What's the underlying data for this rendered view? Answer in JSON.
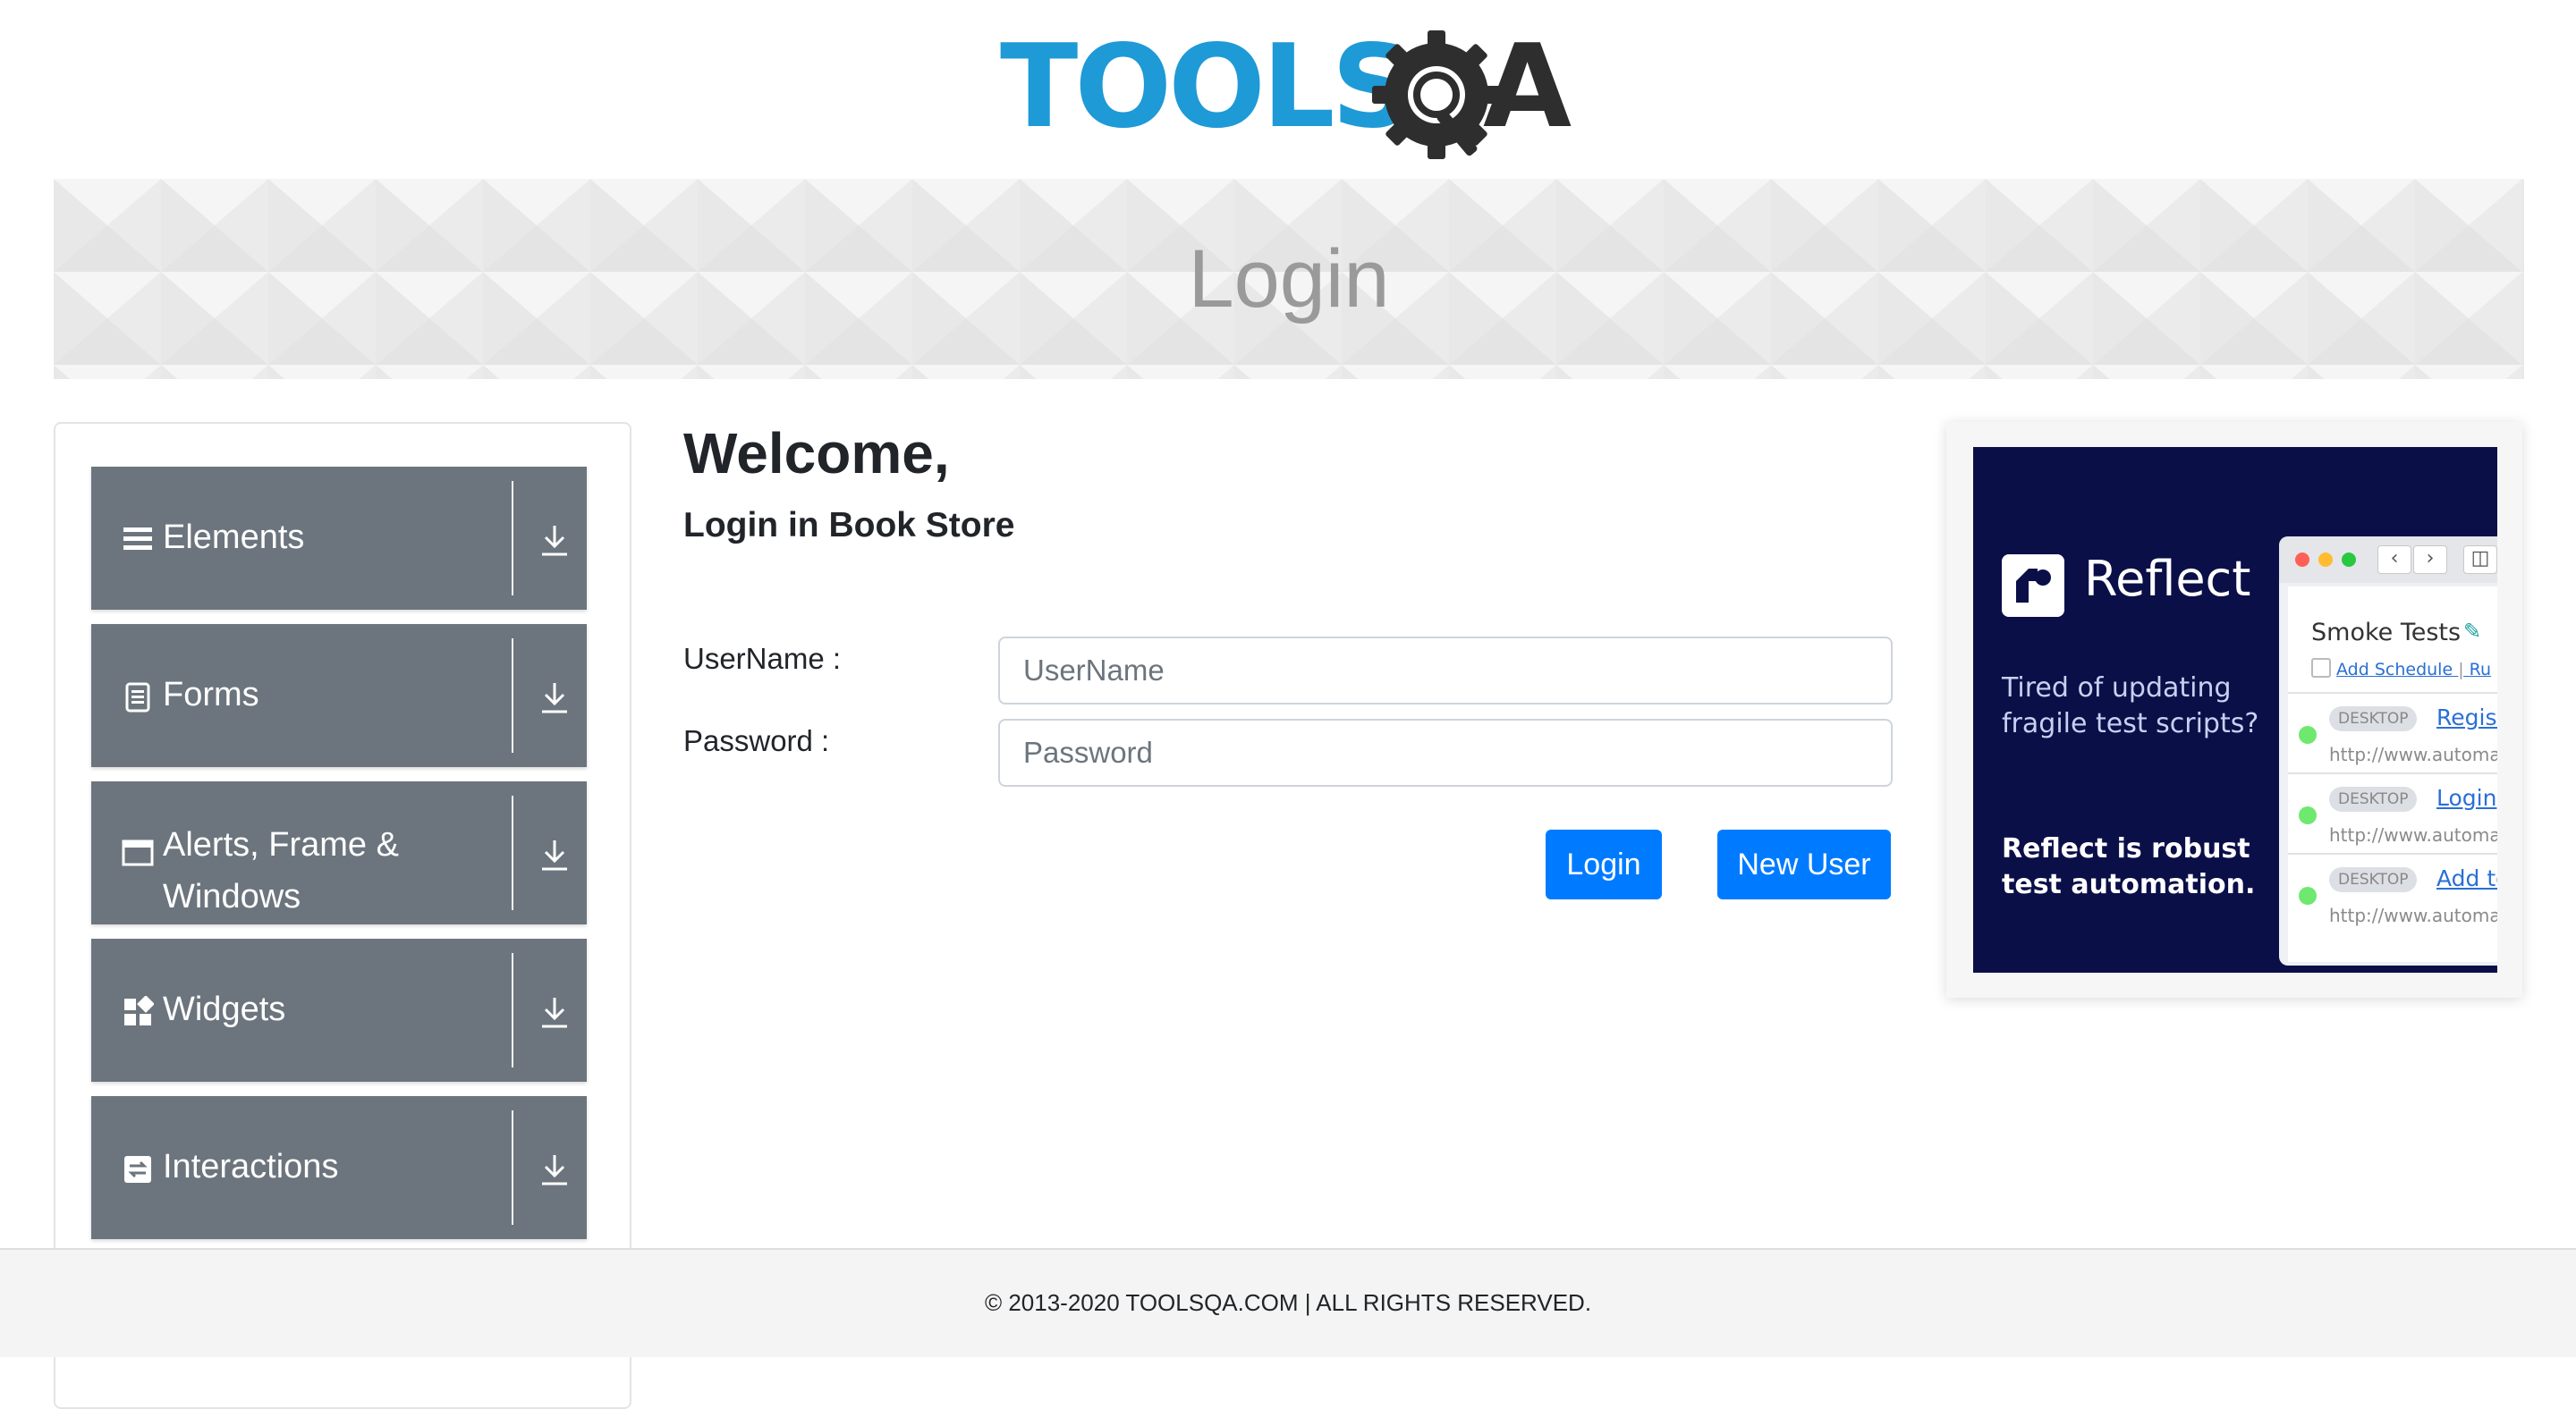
{
  "header": {
    "logo_tools": "TOOLS",
    "logo_a": "A",
    "logo_colors": {
      "tools": "#1e9ad6",
      "qa": "#2e2e2e"
    }
  },
  "banner": {
    "title": "Login"
  },
  "sidebar": {
    "items": [
      {
        "label": "Elements",
        "icon": "hamburger-icon"
      },
      {
        "label": "Forms",
        "icon": "document-icon"
      },
      {
        "label": "Alerts, Frame &",
        "label2": "Windows",
        "icon": "window-icon"
      },
      {
        "label": "Widgets",
        "icon": "widgets-icon"
      },
      {
        "label": "Interactions",
        "icon": "interactions-icon"
      }
    ],
    "expand_icon": "download-arrow-icon"
  },
  "main": {
    "welcome": "Welcome,",
    "subtitle": "Login in Book Store",
    "username_label": "UserName :",
    "username_placeholder": "UserName",
    "password_label": "Password :",
    "password_placeholder": "Password",
    "login_button": "Login",
    "new_user_button": "New User"
  },
  "ad": {
    "brand": "Reflect",
    "tagline": "Tired of updating fragile test scripts?",
    "tagline2": "Reflect is robust test automation.",
    "window_title": "Smoke Tests",
    "schedule_link": "Add Schedule",
    "schedule_sep": "|",
    "schedule_more": "Ru",
    "rows": [
      {
        "chip": "DESKTOP",
        "link": "Registr",
        "url": "http://www.automat"
      },
      {
        "chip": "DESKTOP",
        "link": "Login",
        "url": "http://www.automat"
      },
      {
        "chip": "DESKTOP",
        "link": "Add to",
        "url": "http://www.automat"
      }
    ]
  },
  "footer": {
    "text": "© 2013-2020 TOOLSQA.COM | ALL RIGHTS RESERVED."
  },
  "colors": {
    "primary": "#007bff",
    "sidebar_group": "#6c757d",
    "ad_bg": "#0b0f48"
  }
}
